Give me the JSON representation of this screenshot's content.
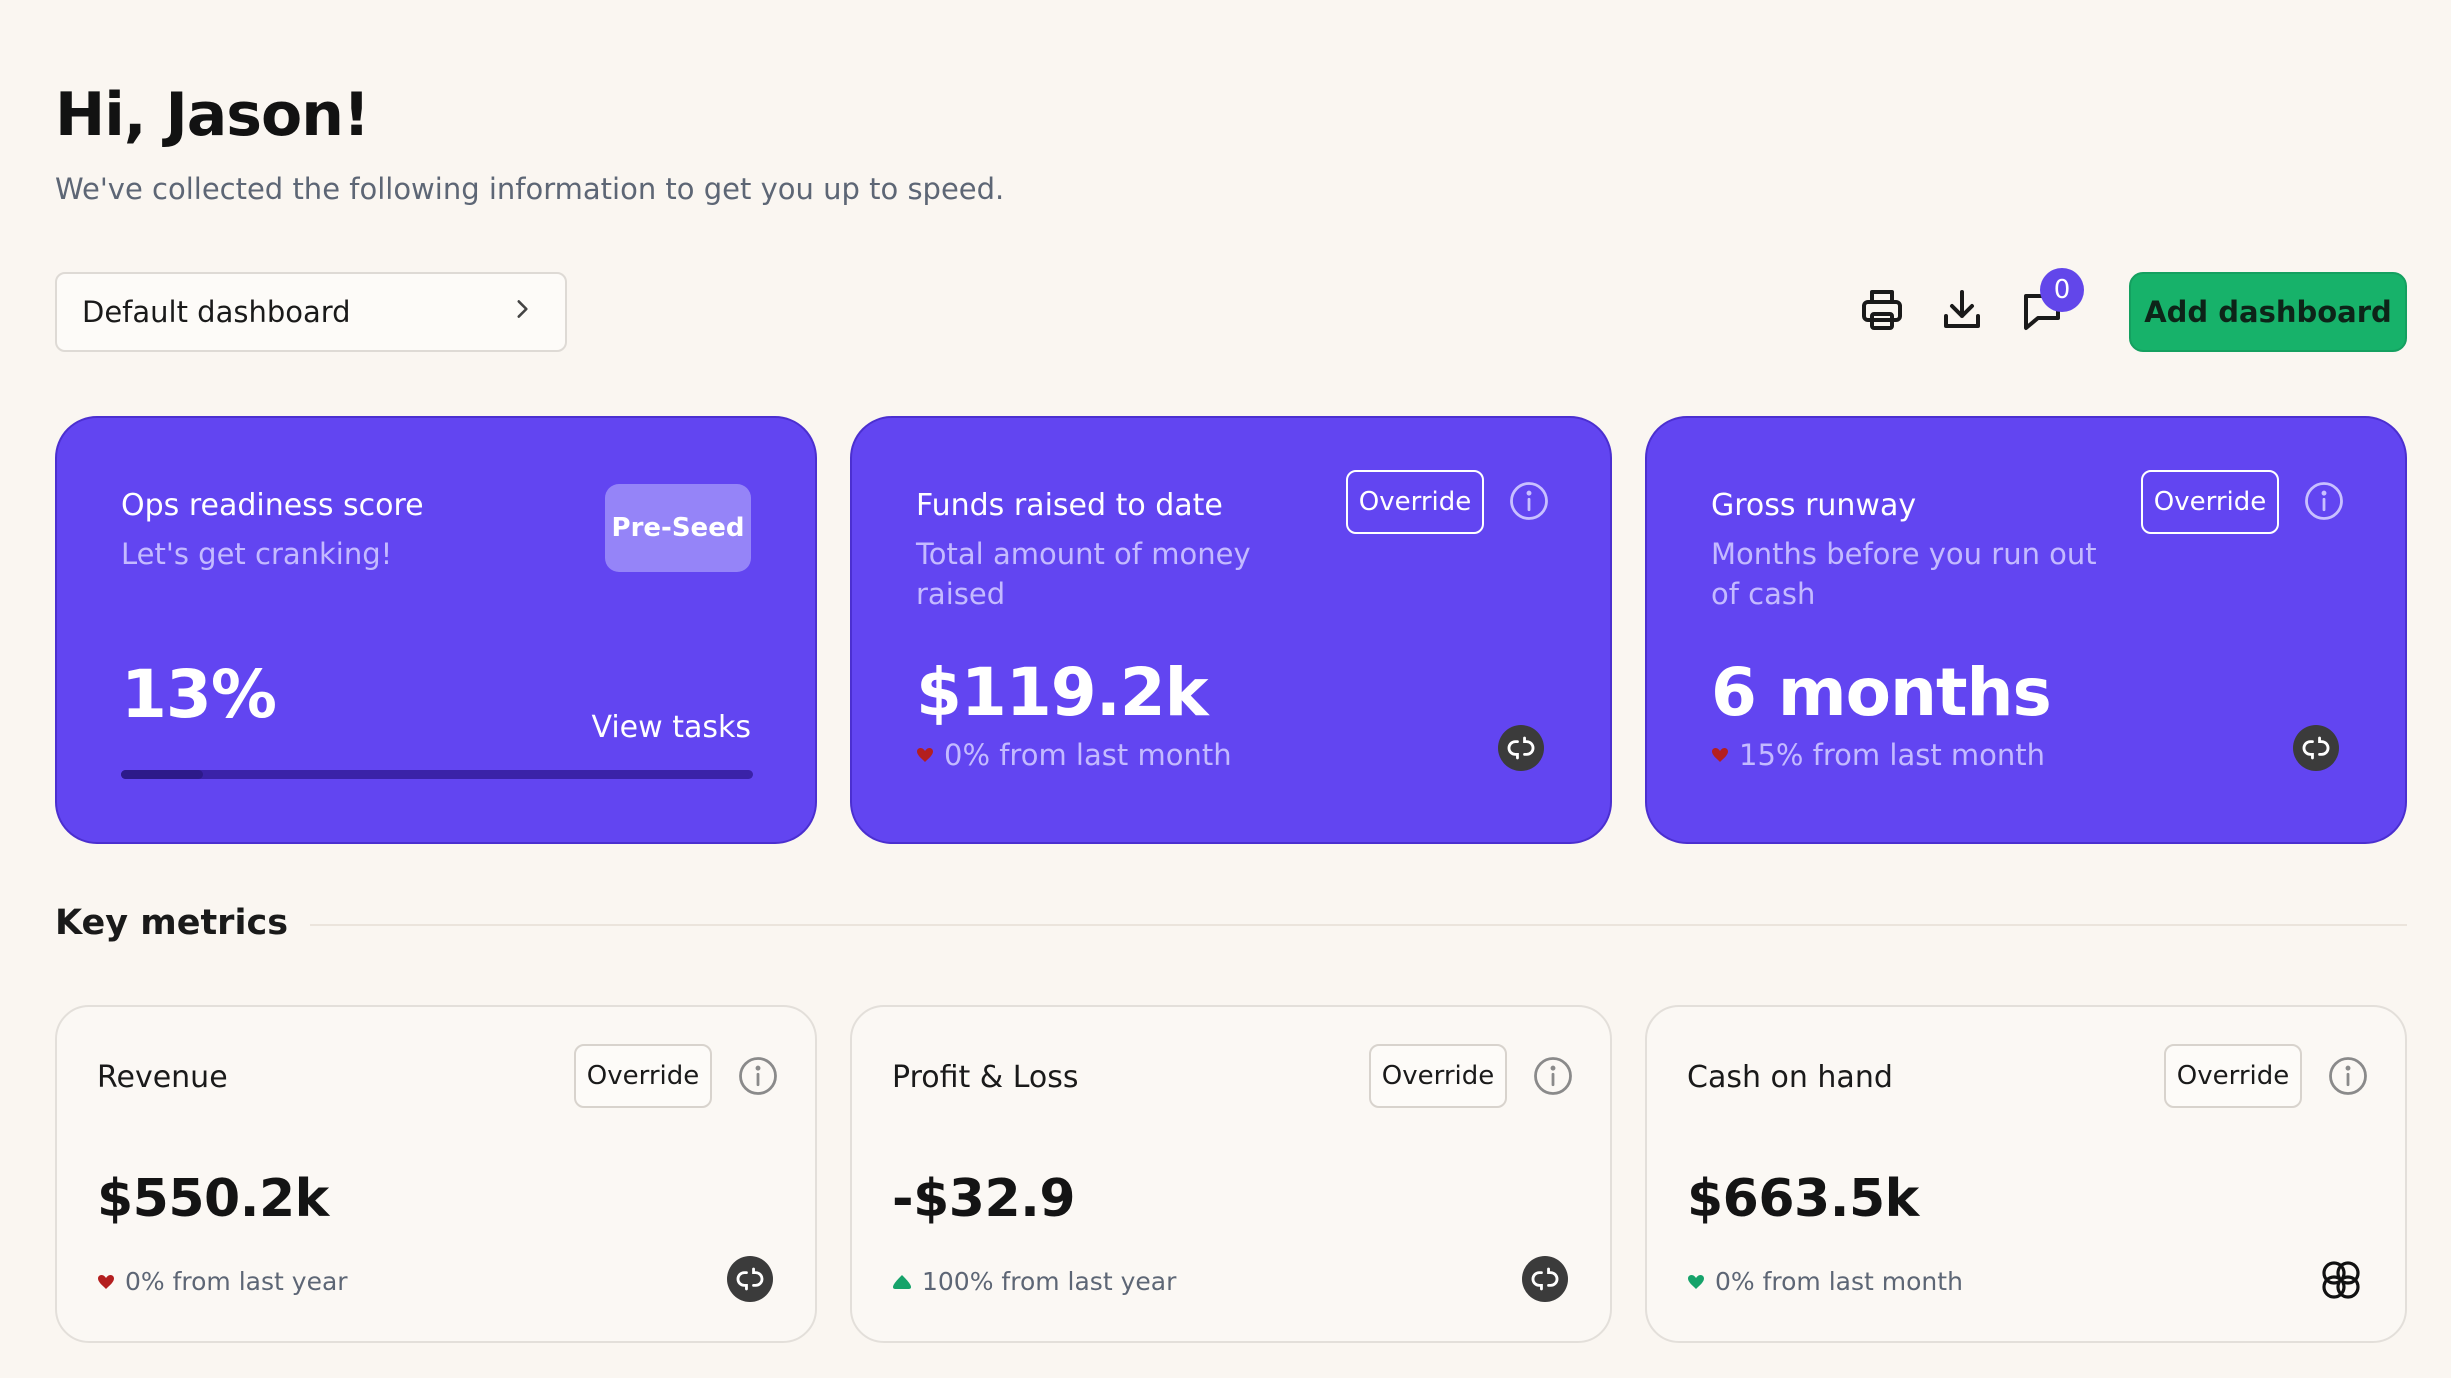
{
  "header": {
    "greeting": "Hi, Jason!",
    "subtitle": "We've collected the following information to get you up to speed."
  },
  "toolbar": {
    "dashboard_select_value": "Default dashboard",
    "print_icon": "printer-icon",
    "download_icon": "download-icon",
    "comments_icon": "comment-icon",
    "comments_count": "0",
    "add_button_label": "Add dashboard"
  },
  "hero_cards": [
    {
      "title": "Ops readiness score",
      "subtitle": "Let's get cranking!",
      "tag": "Pre-Seed",
      "value": "13%",
      "progress": 0.13,
      "link": "View tasks"
    },
    {
      "title": "Funds raised to date",
      "subtitle": "Total amount of money raised",
      "override": "Override",
      "value": "$119.2k",
      "change": "0% from last month",
      "trend": "down",
      "source_icon": "quickbooks-logo"
    },
    {
      "title": "Gross runway",
      "subtitle": "Months before you run out of cash",
      "override": "Override",
      "value": "6 months",
      "change": "15% from last month",
      "trend": "down",
      "source_icon": "quickbooks-logo"
    }
  ],
  "key_metrics": {
    "title": "Key metrics",
    "cards": [
      {
        "title": "Revenue",
        "override": "Override",
        "value": "$550.2k",
        "change": "0% from last year",
        "trend": "down",
        "source_icon": "quickbooks-logo"
      },
      {
        "title": "Profit & Loss",
        "override": "Override",
        "value": "-$32.9",
        "change": "100% from last year",
        "trend": "up",
        "source_icon": "quickbooks-logo"
      },
      {
        "title": "Cash on hand",
        "override": "Override",
        "value": "$663.5k",
        "change": "0% from last month",
        "trend": "down-green",
        "source_icon": "mercury-logo"
      }
    ]
  },
  "colors": {
    "background": "#faf6f1",
    "hero": "#6245f1",
    "accent_green": "#17b26a",
    "trend_down": "#b41f1f",
    "trend_up": "#16a36a"
  }
}
